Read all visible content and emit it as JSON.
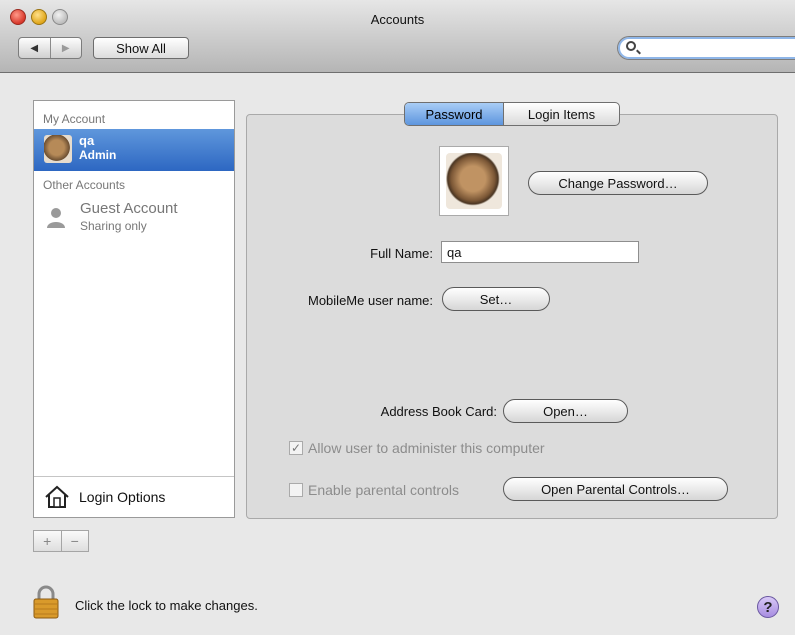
{
  "window": {
    "title": "Accounts"
  },
  "toolbar": {
    "back_glyph": "◀",
    "forward_glyph": "▶",
    "show_all_label": "Show All",
    "search_value": "",
    "search_placeholder": ""
  },
  "sidebar": {
    "my_account_header": "My Account",
    "current_account": {
      "name": "qa",
      "role": "Admin"
    },
    "other_accounts_header": "Other Accounts",
    "other_accounts": [
      {
        "name": "Guest Account",
        "role": "Sharing only"
      }
    ],
    "login_options_label": "Login Options",
    "add_label": "+",
    "remove_label": "−"
  },
  "tabs": [
    {
      "label": "Password",
      "selected": true
    },
    {
      "label": "Login Items",
      "selected": false
    }
  ],
  "panel": {
    "change_password_label": "Change Password…",
    "full_name_label": "Full Name:",
    "full_name_value": "qa",
    "mobileme_label": "MobileMe user name:",
    "set_label": "Set…",
    "address_book_label": "Address Book Card:",
    "open_label": "Open…",
    "allow_admin_label": "Allow user to administer this computer",
    "allow_admin_checked": true,
    "parental_label": "Enable parental controls",
    "parental_checked": false,
    "open_parental_label": "Open Parental Controls…"
  },
  "footer": {
    "lock_text": "Click the lock to make changes.",
    "help_label": "?"
  },
  "colors": {
    "selection": "#3b78cf",
    "selected_tab": "#6fa3e6",
    "panel_bg": "#dcdcdc"
  },
  "icons": [
    "close-icon",
    "minimize-icon",
    "zoom-icon",
    "search-icon",
    "user-photo-icon",
    "guest-icon",
    "house-icon",
    "lock-icon",
    "help-icon"
  ]
}
